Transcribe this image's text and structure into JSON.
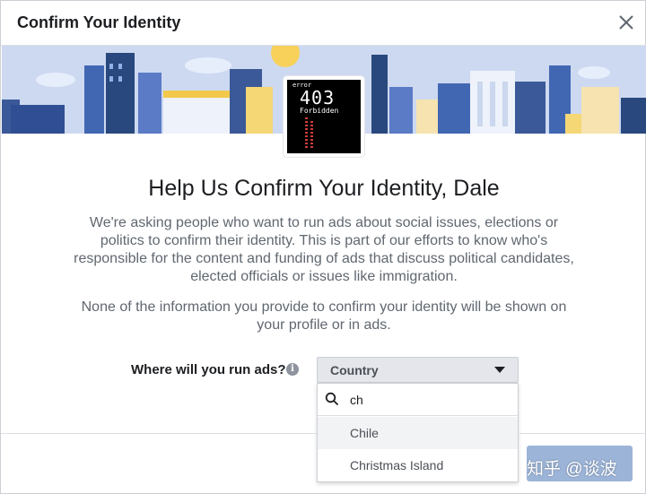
{
  "dialog": {
    "title": "Confirm Your Identity",
    "close_icon": "close-icon"
  },
  "banner": {
    "illustration": "city-skyline-illustration",
    "error_badge": {
      "small_text": "error",
      "code": "403",
      "message": "Forbidden"
    }
  },
  "content": {
    "heading": "Help Us Confirm Your Identity, Dale",
    "paragraph1": "We're asking people who want to run ads about social issues, elections or politics to confirm their identity. This is part of our efforts to know who's responsible for the content and funding of ads that discuss political candidates, elected officials or issues like immigration.",
    "paragraph2": "None of the information you provide to confirm your identity will be shown on your profile or in ads."
  },
  "country_picker": {
    "question": "Where will you run ads?",
    "info_icon": "info-icon",
    "selected_label": "Country",
    "search_value": "ch",
    "options": [
      "Chile",
      "Christmas Island"
    ]
  },
  "watermark": "知乎 @谈波",
  "colors": {
    "accent": "#1877f2",
    "disabled_button": "#9cb4d8",
    "banner_bg": "#ccd9f2",
    "text_muted": "#606770"
  }
}
